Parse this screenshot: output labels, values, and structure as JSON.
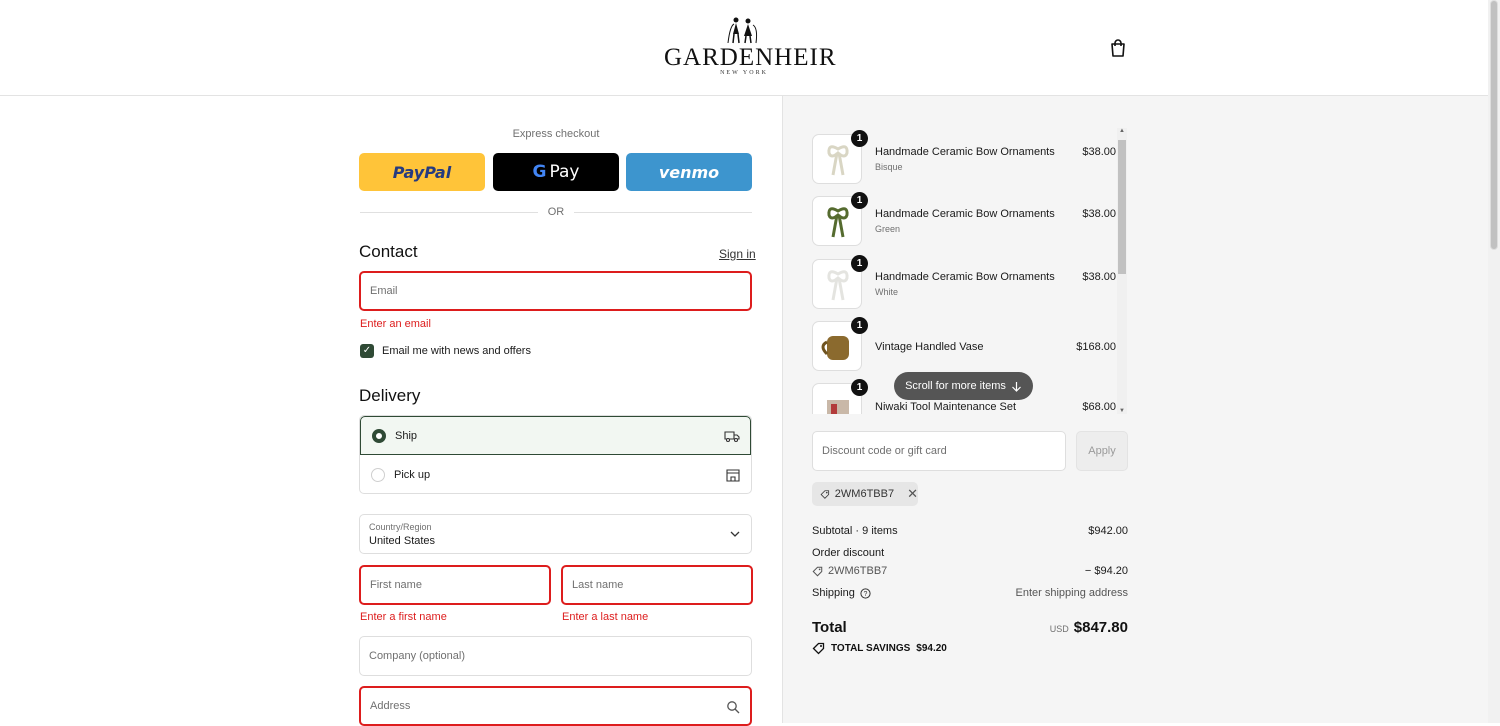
{
  "header": {
    "brand": "GARDENHEIR",
    "city": "NEW YORK"
  },
  "express": {
    "label": "Express checkout",
    "paypal": "PayPal",
    "gpay": "Pay",
    "venmo": "venmo",
    "or": "OR"
  },
  "contact": {
    "title": "Contact",
    "sign_in": "Sign in",
    "email_placeholder": "Email",
    "email_error": "Enter an email",
    "news_label": "Email me with news and offers"
  },
  "delivery": {
    "title": "Delivery",
    "ship": "Ship",
    "pickup": "Pick up",
    "country_label": "Country/Region",
    "country_value": "United States",
    "first_name": "First name",
    "first_name_error": "Enter a first name",
    "last_name": "Last name",
    "last_name_error": "Enter a last name",
    "company": "Company (optional)",
    "address": "Address"
  },
  "cart": {
    "items": [
      {
        "qty": "1",
        "name": "Handmade Ceramic Bow Ornaments",
        "variant": "Bisque",
        "price": "$38.00"
      },
      {
        "qty": "1",
        "name": "Handmade Ceramic Bow Ornaments",
        "variant": "Green",
        "price": "$38.00"
      },
      {
        "qty": "1",
        "name": "Handmade Ceramic Bow Ornaments",
        "variant": "White",
        "price": "$38.00"
      },
      {
        "qty": "1",
        "name": "Vintage Handled Vase",
        "variant": "",
        "price": "$168.00"
      },
      {
        "qty": "1",
        "name": "Niwaki Tool Maintenance Set",
        "variant": "",
        "price": "$68.00"
      }
    ],
    "scroll_hint": "Scroll for more items"
  },
  "discount": {
    "placeholder": "Discount code or gift card",
    "apply": "Apply",
    "code": "2WM6TBB7"
  },
  "summary": {
    "subtotal_label": "Subtotal · 9 items",
    "subtotal_value": "$942.00",
    "order_discount_label": "Order discount",
    "discount_code": "2WM6TBB7",
    "discount_value": "− $94.20",
    "shipping_label": "Shipping",
    "shipping_value": "Enter shipping address",
    "total_label": "Total",
    "currency": "USD",
    "total_value": "$847.80",
    "savings_label": "TOTAL SAVINGS",
    "savings_value": "$94.20"
  },
  "colors": {
    "accent": "#2f4a35",
    "error": "#dd1d1d",
    "paypal": "#ffc439",
    "venmo": "#3d95ce"
  }
}
